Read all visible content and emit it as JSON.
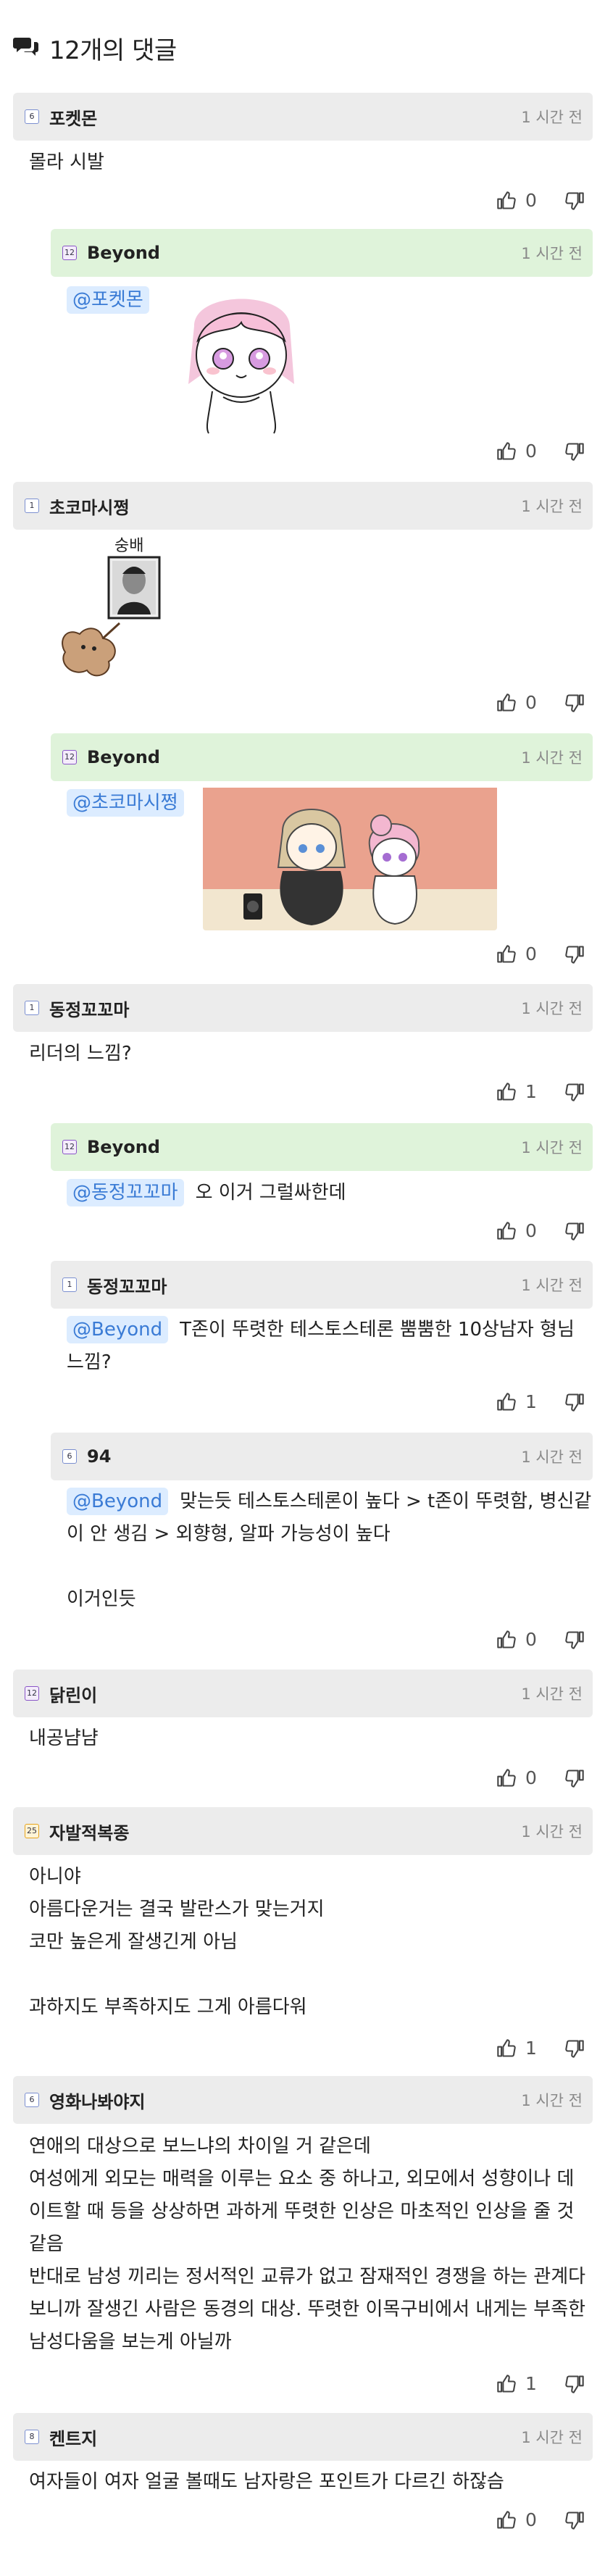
{
  "header": {
    "title": "12개의 댓글",
    "icon": "speech-bubbles-icon"
  },
  "comments": [
    {
      "id": "c1",
      "nick": "포켓몬",
      "level": "6",
      "time": "1 시간 전",
      "text": "몰라 시발",
      "likes": "0"
    },
    {
      "id": "c2",
      "nick": "Beyond",
      "level": "12",
      "time": "1 시간 전",
      "mention": "@포켓몬",
      "likes": "0"
    },
    {
      "id": "c3",
      "nick": "초코마시쩡",
      "level": "1",
      "time": "1 시간 전",
      "image_caption": "숭배",
      "likes": "0"
    },
    {
      "id": "c4",
      "nick": "Beyond",
      "level": "12",
      "time": "1 시간 전",
      "mention": "@초코마시쩡",
      "likes": "0"
    },
    {
      "id": "c5",
      "nick": "동정꼬꼬마",
      "level": "1",
      "time": "1 시간 전",
      "text": "리더의 느낌?",
      "likes": "1"
    },
    {
      "id": "c6",
      "nick": "Beyond",
      "level": "12",
      "time": "1 시간 전",
      "mention": "@동정꼬꼬마",
      "text": "오 이거 그럴싸한데",
      "likes": "0"
    },
    {
      "id": "c7",
      "nick": "동정꼬꼬마",
      "level": "1",
      "time": "1 시간 전",
      "mention": "@Beyond",
      "text1": "T존이 뚜렷한 테스토스테론 뿜뿜한 10상남자 형님",
      "text2": "느낌?",
      "likes": "1"
    },
    {
      "id": "c8",
      "nick": "94",
      "level": "6",
      "time": "1 시간 전",
      "mention": "@Beyond",
      "text1": "맞는듯 테스토스테론이 높다 > t존이 뚜렷함, 병신같",
      "text2": "이 안 생김 > 외향형, 알파 가능성이 높다",
      "text3": "이거인듯",
      "likes": "0"
    },
    {
      "id": "c9",
      "nick": "닭린이",
      "level": "12",
      "time": "1 시간 전",
      "text": "내공냠냠",
      "likes": "0"
    },
    {
      "id": "c10",
      "nick": "자발적복종",
      "level": "25",
      "time": "1 시간 전",
      "text1": "아니야",
      "text2": "아름다운거는 결국 발란스가 맞는거지",
      "text3": "코만 높은게 잘생긴게 아님",
      "text4": "과하지도 부족하지도 그게 아름다워",
      "likes": "1"
    },
    {
      "id": "c11",
      "nick": "영화나봐야지",
      "level": "6",
      "time": "1 시간 전",
      "text1": "연애의 대상으로 보느냐의 차이일 거 같은데",
      "text2": "여성에게 외모는 매력을 이루는 요소 중 하나고, 외모에서 성향이나 데",
      "text3": "이트할 때 등을 상상하면 과하게 뚜렷한 인상은 마초적인 인상을 줄 것",
      "text4": "같음",
      "text5": "반대로 남성 끼리는 정서적인 교류가 없고 잠재적인 경쟁을 하는 관계다",
      "text6": "보니까 잘생긴 사람은 동경의 대상. 뚜렷한 이목구비에서 내게는 부족한",
      "text7": "남성다움을 보는게 아닐까",
      "likes": "1"
    },
    {
      "id": "c12",
      "nick": "켄트지",
      "level": "8",
      "time": "1 시간 전",
      "text": "여자들이 여자 얼굴 볼때도 남자랑은 포인트가 다르긴 하잖슴",
      "likes": "0"
    }
  ],
  "colors": {
    "bar_gray": "#ececec",
    "bar_green": "#dff3da",
    "mention_bg": "#dcecff",
    "mention_fg": "#3a7bd5"
  },
  "icons": {
    "like": "thumbs-up-icon",
    "dislike": "thumbs-down-icon",
    "level": "level-badge-icon"
  }
}
